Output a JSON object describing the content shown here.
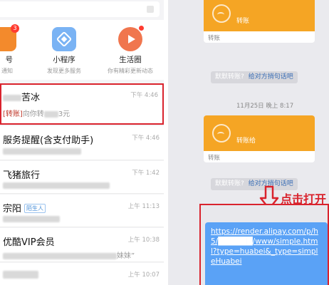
{
  "shortcuts": [
    {
      "label": "号",
      "sub": "通知",
      "badge": "3",
      "icon": "service-account-icon"
    },
    {
      "label": "小程序",
      "sub": "发现更多服务",
      "icon": "mini-program-icon"
    },
    {
      "label": "生活圈",
      "sub": "你有精彩更新动态",
      "icon": "life-circle-icon"
    }
  ],
  "chats": [
    {
      "title": "苦冰",
      "time": "下午 4:46",
      "preview_tag": "[转账]",
      "preview_text": "向你转",
      "preview_tail": "3元"
    },
    {
      "title": "服务提醒(含支付助手)",
      "time": "下午 4:46"
    },
    {
      "title": "飞猪旅行",
      "time": "下午 1:42"
    },
    {
      "title": "宗阳",
      "stranger": "陌生人",
      "time": "上午 11:13"
    },
    {
      "title": "优酷VIP会员",
      "time": "上午 10:38",
      "preview_tail": "妹妹”"
    },
    {
      "title": "",
      "time": "上午 10:07"
    }
  ],
  "conversation": {
    "transfers": [
      {
        "top_text": "转账",
        "bottom_label": "转账"
      },
      {
        "top_text": "转账给",
        "bottom_label": "转账"
      }
    ],
    "notice_prefix": "默默转账?",
    "notice_link": "给对方捎句话吧",
    "date_stamp": "11月25日 晚上 8:17",
    "callout": "点击打开",
    "link_text": "https://render.alipay.com/p/h5/██████/www/simple.html?type=huabei&_type=simpleHuabei"
  },
  "colors": {
    "highlight": "#d9232d",
    "transfer_card": "#f5a524",
    "link_bubble": "#5aa2f6"
  }
}
